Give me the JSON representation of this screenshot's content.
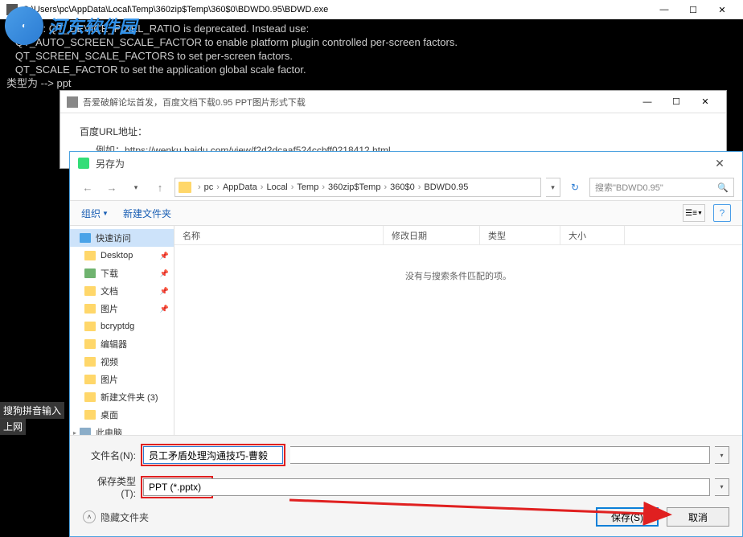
{
  "console": {
    "title": "C:\\Users\\pc\\AppData\\Local\\Temp\\360zip$Temp\\360$0\\BDWD0.95\\BDWD.exe",
    "lines": [
      "warning: QT_DEVICE_PIXEL_RATIO is deprecated. Instead use:",
      "   QT_AUTO_SCREEN_SCALE_FACTOR to enable platform plugin controlled per-screen factors.",
      "   QT_SCREEN_SCALE_FACTORS to set per-screen factors.",
      "   QT_SCALE_FACTOR to set the application global scale factor.",
      "类型为 --> ppt"
    ],
    "controls": {
      "min": "—",
      "max": "☐",
      "close": "✕"
    }
  },
  "watermark": {
    "text": "河东软件园"
  },
  "mid_dialog": {
    "title": "吾爱破解论坛首发，百度文档下载0.95 PPT图片形式下载",
    "url_label": "百度URL地址：",
    "example_prefix": "例如：",
    "example_url": "https://wenku.baidu.com/view/f2d2dcaaf524ccbff0218412.html",
    "controls": {
      "min": "—",
      "max": "☐",
      "close": "✕"
    }
  },
  "saveas": {
    "title": "另存为",
    "close": "✕",
    "nav": {
      "back": "←",
      "fwd": "→",
      "up": "↑"
    },
    "breadcrumb": [
      "pc",
      "AppData",
      "Local",
      "Temp",
      "360zip$Temp",
      "360$0",
      "BDWD0.95"
    ],
    "refresh": "↻",
    "search_placeholder": "搜索\"BDWD0.95\"",
    "toolbar": {
      "organize": "组织",
      "newfolder": "新建文件夹",
      "view": "☰≡",
      "help": "?"
    },
    "tree": [
      {
        "label": "快速访问",
        "icon": "star",
        "lvl": 1,
        "selected": true,
        "pin": ""
      },
      {
        "label": "Desktop",
        "icon": "folder",
        "pin": "📌"
      },
      {
        "label": "下载",
        "icon": "down",
        "pin": "📌"
      },
      {
        "label": "文档",
        "icon": "folder",
        "pin": "📌"
      },
      {
        "label": "图片",
        "icon": "folder",
        "pin": "📌"
      },
      {
        "label": "bcryptdg",
        "icon": "folder"
      },
      {
        "label": "编辑器",
        "icon": "folder"
      },
      {
        "label": "视频",
        "icon": "folder"
      },
      {
        "label": "图片",
        "icon": "folder"
      },
      {
        "label": "新建文件夹 (3)",
        "icon": "folder"
      },
      {
        "label": "桌面",
        "icon": "folder"
      },
      {
        "label": "此电脑",
        "icon": "disk",
        "lvl": 1,
        "expand": "▸"
      }
    ],
    "columns": {
      "name": "名称",
      "date": "修改日期",
      "type": "类型",
      "size": "大小"
    },
    "empty_msg": "没有与搜索条件匹配的项。",
    "filename_label": "文件名(N):",
    "filename_value": "员工矛盾处理沟通技巧-曹毅",
    "filetype_label": "保存类型(T):",
    "filetype_value": "PPT (*.pptx)",
    "hide_folders": "隐藏文件夹",
    "save_btn": "保存(S)",
    "cancel_btn": "取消"
  },
  "edge": {
    "ime": "搜狗拼音输入",
    "net": "上网"
  }
}
